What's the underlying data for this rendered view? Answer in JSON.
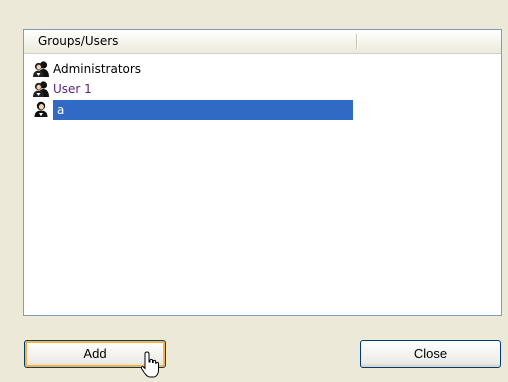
{
  "listview": {
    "columns": [
      "Groups/Users",
      ""
    ],
    "rows": [
      {
        "label": "Administrators",
        "icon": "user-group-icon",
        "style": "normal"
      },
      {
        "label": "User 1",
        "icon": "user-group-icon",
        "style": "purple"
      },
      {
        "label": "a",
        "icon": "user-icon",
        "style": "selected"
      }
    ]
  },
  "buttons": {
    "add_label": "Add",
    "close_label": "Close"
  },
  "colors": {
    "selection": "#316ac5",
    "purple_text": "#5a1e78",
    "dialog_bg": "#ece9d8",
    "focus_ring": "#f8b33c"
  }
}
